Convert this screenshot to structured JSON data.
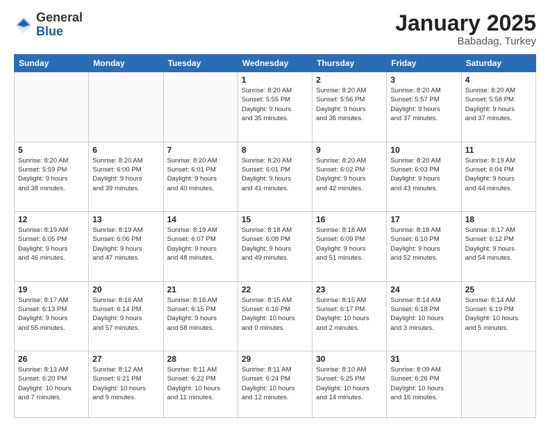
{
  "header": {
    "logo_general": "General",
    "logo_blue": "Blue",
    "month_year": "January 2025",
    "location": "Babadag, Turkey"
  },
  "days_of_week": [
    "Sunday",
    "Monday",
    "Tuesday",
    "Wednesday",
    "Thursday",
    "Friday",
    "Saturday"
  ],
  "weeks": [
    [
      {
        "day": "",
        "info": ""
      },
      {
        "day": "",
        "info": ""
      },
      {
        "day": "",
        "info": ""
      },
      {
        "day": "1",
        "info": "Sunrise: 8:20 AM\nSunset: 5:55 PM\nDaylight: 9 hours\nand 35 minutes."
      },
      {
        "day": "2",
        "info": "Sunrise: 8:20 AM\nSunset: 5:56 PM\nDaylight: 9 hours\nand 36 minutes."
      },
      {
        "day": "3",
        "info": "Sunrise: 8:20 AM\nSunset: 5:57 PM\nDaylight: 9 hours\nand 37 minutes."
      },
      {
        "day": "4",
        "info": "Sunrise: 8:20 AM\nSunset: 5:58 PM\nDaylight: 9 hours\nand 37 minutes."
      }
    ],
    [
      {
        "day": "5",
        "info": "Sunrise: 8:20 AM\nSunset: 5:59 PM\nDaylight: 9 hours\nand 38 minutes."
      },
      {
        "day": "6",
        "info": "Sunrise: 8:20 AM\nSunset: 6:00 PM\nDaylight: 9 hours\nand 39 minutes."
      },
      {
        "day": "7",
        "info": "Sunrise: 8:20 AM\nSunset: 6:01 PM\nDaylight: 9 hours\nand 40 minutes."
      },
      {
        "day": "8",
        "info": "Sunrise: 8:20 AM\nSunset: 6:01 PM\nDaylight: 9 hours\nand 41 minutes."
      },
      {
        "day": "9",
        "info": "Sunrise: 8:20 AM\nSunset: 6:02 PM\nDaylight: 9 hours\nand 42 minutes."
      },
      {
        "day": "10",
        "info": "Sunrise: 8:20 AM\nSunset: 6:03 PM\nDaylight: 9 hours\nand 43 minutes."
      },
      {
        "day": "11",
        "info": "Sunrise: 8:19 AM\nSunset: 6:04 PM\nDaylight: 9 hours\nand 44 minutes."
      }
    ],
    [
      {
        "day": "12",
        "info": "Sunrise: 8:19 AM\nSunset: 6:05 PM\nDaylight: 9 hours\nand 46 minutes."
      },
      {
        "day": "13",
        "info": "Sunrise: 8:19 AM\nSunset: 6:06 PM\nDaylight: 9 hours\nand 47 minutes."
      },
      {
        "day": "14",
        "info": "Sunrise: 8:19 AM\nSunset: 6:07 PM\nDaylight: 9 hours\nand 48 minutes."
      },
      {
        "day": "15",
        "info": "Sunrise: 8:18 AM\nSunset: 6:08 PM\nDaylight: 9 hours\nand 49 minutes."
      },
      {
        "day": "16",
        "info": "Sunrise: 8:18 AM\nSunset: 6:09 PM\nDaylight: 9 hours\nand 51 minutes."
      },
      {
        "day": "17",
        "info": "Sunrise: 8:18 AM\nSunset: 6:10 PM\nDaylight: 9 hours\nand 52 minutes."
      },
      {
        "day": "18",
        "info": "Sunrise: 8:17 AM\nSunset: 6:12 PM\nDaylight: 9 hours\nand 54 minutes."
      }
    ],
    [
      {
        "day": "19",
        "info": "Sunrise: 8:17 AM\nSunset: 6:13 PM\nDaylight: 9 hours\nand 55 minutes."
      },
      {
        "day": "20",
        "info": "Sunrise: 8:16 AM\nSunset: 6:14 PM\nDaylight: 9 hours\nand 57 minutes."
      },
      {
        "day": "21",
        "info": "Sunrise: 8:16 AM\nSunset: 6:15 PM\nDaylight: 9 hours\nand 58 minutes."
      },
      {
        "day": "22",
        "info": "Sunrise: 8:15 AM\nSunset: 6:16 PM\nDaylight: 10 hours\nand 0 minutes."
      },
      {
        "day": "23",
        "info": "Sunrise: 8:15 AM\nSunset: 6:17 PM\nDaylight: 10 hours\nand 2 minutes."
      },
      {
        "day": "24",
        "info": "Sunrise: 8:14 AM\nSunset: 6:18 PM\nDaylight: 10 hours\nand 3 minutes."
      },
      {
        "day": "25",
        "info": "Sunrise: 8:14 AM\nSunset: 6:19 PM\nDaylight: 10 hours\nand 5 minutes."
      }
    ],
    [
      {
        "day": "26",
        "info": "Sunrise: 8:13 AM\nSunset: 6:20 PM\nDaylight: 10 hours\nand 7 minutes."
      },
      {
        "day": "27",
        "info": "Sunrise: 8:12 AM\nSunset: 6:21 PM\nDaylight: 10 hours\nand 9 minutes."
      },
      {
        "day": "28",
        "info": "Sunrise: 8:11 AM\nSunset: 6:22 PM\nDaylight: 10 hours\nand 11 minutes."
      },
      {
        "day": "29",
        "info": "Sunrise: 8:11 AM\nSunset: 6:24 PM\nDaylight: 10 hours\nand 12 minutes."
      },
      {
        "day": "30",
        "info": "Sunrise: 8:10 AM\nSunset: 6:25 PM\nDaylight: 10 hours\nand 14 minutes."
      },
      {
        "day": "31",
        "info": "Sunrise: 8:09 AM\nSunset: 6:26 PM\nDaylight: 10 hours\nand 16 minutes."
      },
      {
        "day": "",
        "info": ""
      }
    ]
  ]
}
